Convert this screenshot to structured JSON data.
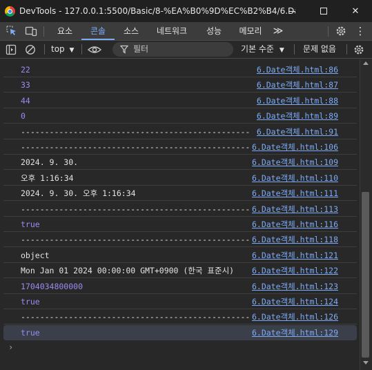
{
  "window": {
    "title": "DevTools - 127.0.0.1:5500/Basic/8-%EA%B0%9D%EC%B2%B4/6.Dat...",
    "minimize_icon": "minimize-icon",
    "maximize_icon": "maximize-icon",
    "close_glyph": "✕"
  },
  "tabs": {
    "items": [
      {
        "label": "요소"
      },
      {
        "label": "콘솔"
      },
      {
        "label": "소스"
      },
      {
        "label": "네트워크"
      },
      {
        "label": "성능"
      },
      {
        "label": "메모리"
      }
    ],
    "active": "콘솔",
    "more_glyph": "≫",
    "settings_icon": "gear-icon",
    "menu_glyph": "⋮"
  },
  "toolbar": {
    "context": "top",
    "filter_placeholder": "필터",
    "level": "기본 수준",
    "issues": "문제 없음"
  },
  "console": {
    "rows": [
      {
        "message": "22",
        "kind": "num",
        "source": "6.Date객체.html:86"
      },
      {
        "message": "33",
        "kind": "num",
        "source": "6.Date객체.html:87"
      },
      {
        "message": "44",
        "kind": "num",
        "source": "6.Date객체.html:88"
      },
      {
        "message": "0",
        "kind": "num",
        "source": "6.Date객체.html:89"
      },
      {
        "message": "------------------------------------------------",
        "kind": "plain",
        "source": "6.Date객체.html:91"
      },
      {
        "message": "------------------------------------------------",
        "kind": "plain",
        "source": "6.Date객체.html:106"
      },
      {
        "message": "2024. 9. 30.",
        "kind": "plain",
        "source": "6.Date객체.html:109"
      },
      {
        "message": "오후 1:16:34",
        "kind": "plain",
        "source": "6.Date객체.html:110"
      },
      {
        "message": "2024. 9. 30. 오후 1:16:34",
        "kind": "plain",
        "source": "6.Date객체.html:111"
      },
      {
        "message": "------------------------------------------------",
        "kind": "plain",
        "source": "6.Date객체.html:113"
      },
      {
        "message": "true",
        "kind": "num",
        "source": "6.Date객체.html:116"
      },
      {
        "message": "------------------------------------------------",
        "kind": "plain",
        "source": "6.Date객체.html:118"
      },
      {
        "message": "object",
        "kind": "plain",
        "source": "6.Date객체.html:121"
      },
      {
        "message": "Mon Jan 01 2024 00:00:00 GMT+0900 (한국 표준시)",
        "kind": "plain",
        "source": "6.Date객체.html:122"
      },
      {
        "message": "1704034800000",
        "kind": "num",
        "source": "6.Date객체.html:123"
      },
      {
        "message": "true",
        "kind": "num",
        "source": "6.Date객체.html:124"
      },
      {
        "message": "------------------------------------------------",
        "kind": "plain",
        "source": "6.Date객체.html:126"
      },
      {
        "message": "true",
        "kind": "num",
        "source": "6.Date객체.html:129",
        "highlighted": true
      }
    ],
    "prompt": "›"
  },
  "colors": {
    "accent": "#7cacf8",
    "number": "#9a8cf3",
    "background": "#282828"
  }
}
